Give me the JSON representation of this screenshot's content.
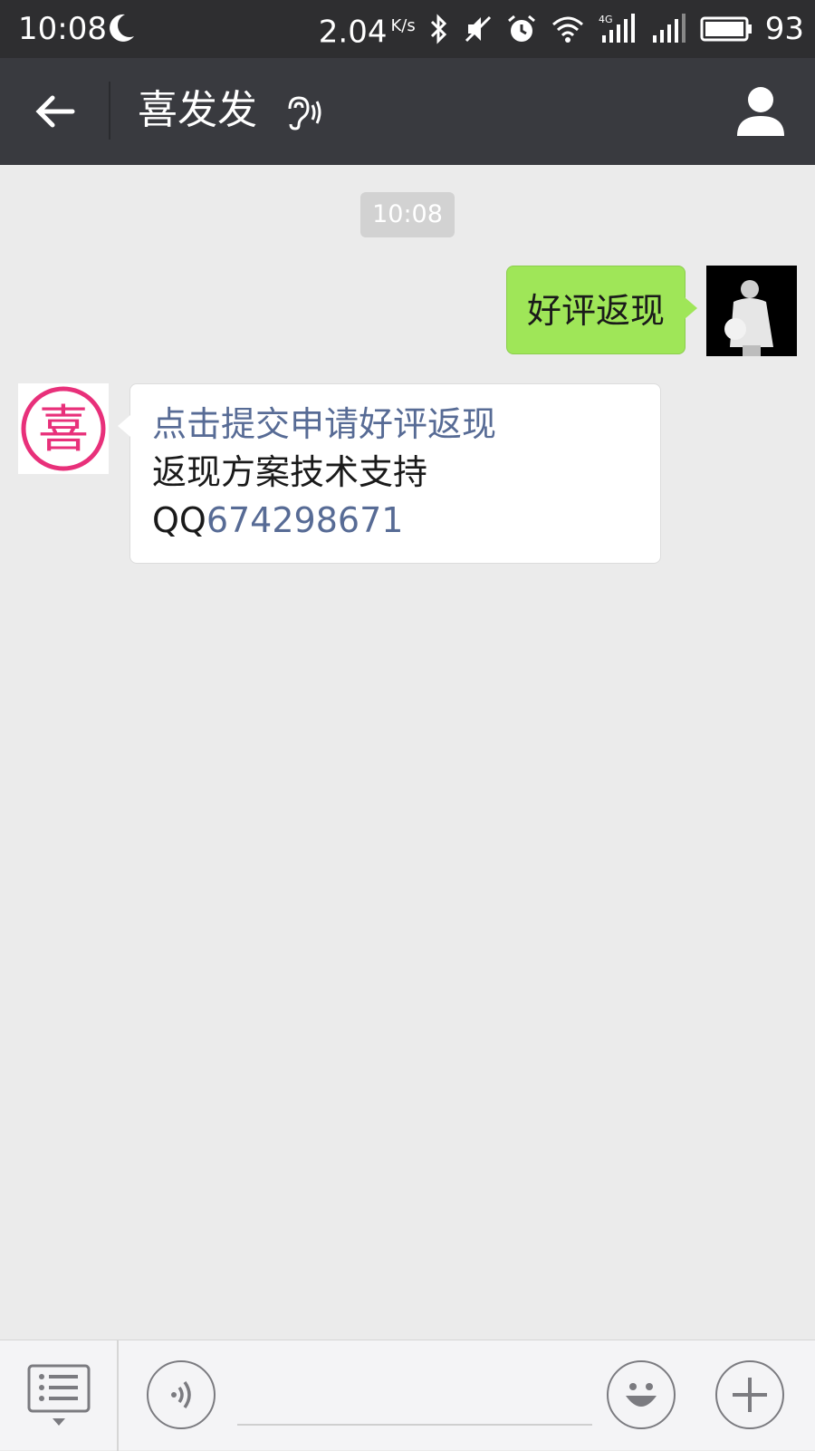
{
  "status_bar": {
    "time": "10:08",
    "speed": "2.04",
    "speed_unit": "K/s",
    "battery": "93",
    "icons": [
      "moon-icon",
      "bluetooth-icon",
      "mute-icon",
      "alarm-icon",
      "wifi-icon",
      "signal-4g-icon",
      "signal-icon",
      "battery-icon"
    ]
  },
  "header": {
    "title": "喜发发",
    "icons": [
      "back-arrow-icon",
      "ear-icon",
      "person-icon"
    ]
  },
  "chat": {
    "timestamp": "10:08",
    "messages": [
      {
        "from": "me",
        "text": "好评返现"
      },
      {
        "from": "other",
        "link_text": "点击提交申请好评返现",
        "line2": "返现方案技术支持",
        "qq_prefix": "QQ",
        "qq_number": "674298671"
      }
    ],
    "other_avatar_char": "喜"
  },
  "colors": {
    "header_bg": "#393a3f",
    "status_bg": "#2e2e30",
    "chat_bg": "#ebebeb",
    "my_bubble": "#9fe658",
    "link": "#576b95",
    "avatar_ring": "#e8307a"
  },
  "input": {
    "placeholder": "",
    "icons": [
      "menu-list-icon",
      "voice-icon",
      "emoji-icon",
      "plus-icon"
    ]
  }
}
